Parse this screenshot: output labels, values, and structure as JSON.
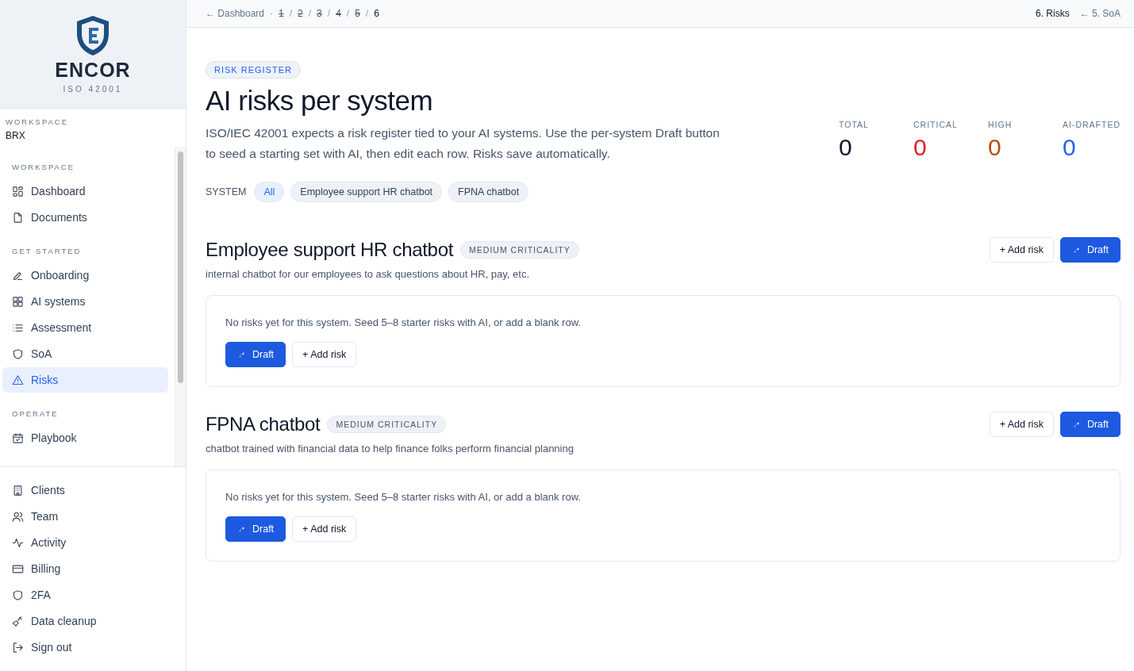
{
  "brand": {
    "name": "ENCOR",
    "subtitle": "ISO 42001"
  },
  "workspace": {
    "label": "WORKSPACE",
    "value": "BRX"
  },
  "nav_sections": [
    {
      "title": "WORKSPACE",
      "items": [
        {
          "label": "Dashboard",
          "selected": false
        },
        {
          "label": "Documents",
          "selected": false
        }
      ]
    },
    {
      "title": "GET STARTED",
      "items": [
        {
          "label": "Onboarding",
          "selected": false
        },
        {
          "label": "AI systems",
          "selected": false
        },
        {
          "label": "Assessment",
          "selected": false
        },
        {
          "label": "SoA",
          "selected": false
        },
        {
          "label": "Risks",
          "selected": true
        }
      ]
    },
    {
      "title": "OPERATE",
      "items": [
        {
          "label": "Playbook",
          "selected": false
        }
      ]
    }
  ],
  "bottom_nav": [
    {
      "label": "Clients"
    },
    {
      "label": "Team"
    },
    {
      "label": "Activity"
    },
    {
      "label": "Billing"
    },
    {
      "label": "2FA"
    },
    {
      "label": "Data cleanup"
    },
    {
      "label": "Sign out"
    }
  ],
  "breadcrumb": {
    "back": "← Dashboard",
    "separator": "·",
    "steps": [
      {
        "label": "1",
        "done": true
      },
      {
        "label": "2",
        "done": true
      },
      {
        "label": "3",
        "done": true
      },
      {
        "label": "4",
        "done": true
      },
      {
        "label": "5",
        "done": true
      },
      {
        "label": "6",
        "done": false
      }
    ],
    "slash": "/",
    "current": "6. Risks",
    "previous": "← 5. SoA"
  },
  "eyebrow": "RISK REGISTER",
  "title": "AI risks per system",
  "intro": "ISO/IEC 42001 expects a risk register tied to your AI systems. Use the per-system Draft button to seed a starting set with AI, then edit each row. Risks save automatically.",
  "stats": [
    {
      "label": "TOTAL",
      "value": "0",
      "color": "#0f172a"
    },
    {
      "label": "CRITICAL",
      "value": "0",
      "color": "#dc2626"
    },
    {
      "label": "HIGH",
      "value": "0",
      "color": "#b45309"
    },
    {
      "label": "AI-DRAFTED",
      "value": "0",
      "color": "#2563eb"
    }
  ],
  "filter": {
    "label": "SYSTEM",
    "options": [
      {
        "label": "All",
        "selected": true
      },
      {
        "label": "Employee support HR chatbot",
        "selected": false
      },
      {
        "label": "FPNA chatbot",
        "selected": false
      }
    ]
  },
  "systems": [
    {
      "name": "Employee support HR chatbot",
      "criticality": "MEDIUM CRITICALITY",
      "description": "internal chatbot for our employees to ask questions about HR, pay, etc.",
      "empty_message": "No risks yet for this system. Seed 5–8 starter risks with AI, or add a blank row.",
      "add_label": "+ Add risk",
      "draft_label": "Draft",
      "card_draft_label": "Draft",
      "card_add_label": "+ Add risk"
    },
    {
      "name": "FPNA chatbot",
      "criticality": "MEDIUM CRITICALITY",
      "description": "chatbot trained with financial data to help finance folks perform financial planning",
      "empty_message": "No risks yet for this system. Seed 5–8 starter risks with AI, or add a blank row.",
      "add_label": "+ Add risk",
      "draft_label": "Draft",
      "card_draft_label": "Draft",
      "card_add_label": "+ Add risk"
    }
  ]
}
